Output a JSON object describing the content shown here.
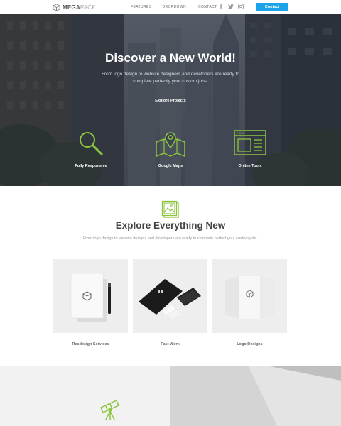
{
  "brand": {
    "name_strong": "MEGA",
    "name_light": "PACK"
  },
  "nav": {
    "links": [
      "FEATURES",
      "DROPDOWN",
      "CONTACT"
    ],
    "social_icons": [
      "facebook-icon",
      "twitter-icon",
      "instagram-icon"
    ],
    "contact_button": "Contact"
  },
  "hero": {
    "title": "Discover a New World!",
    "subtitle": "From logo design to website designers and developers are ready to complete perfectly your custom jobs.",
    "button": "Explore Projects",
    "features": [
      {
        "icon": "magnifier-icon",
        "label": "Fully Responsive"
      },
      {
        "icon": "map-pin-icon",
        "label": "Google Maps"
      },
      {
        "icon": "browser-window-icon",
        "label": "Online Tools"
      }
    ]
  },
  "explore": {
    "icon": "image-gallery-icon",
    "title": "Explore Everything New",
    "subtitle": "From logo design to website designs and developers are ready to complete perfect your custom jobs.",
    "cards": [
      {
        "image": "notebook-pen-mockup",
        "title": "Resdesign Services"
      },
      {
        "image": "stationery-mockup",
        "title": "Fast Work"
      },
      {
        "image": "trifold-brochure-mockup",
        "title": "Logo Designs"
      }
    ]
  },
  "bottom": {
    "icon": "telescope-icon"
  },
  "colors": {
    "accent_blue": "#1aa3e8",
    "accent_green": "#8cc63f",
    "hero_overlay": "#2e3440",
    "heading_text": "#444444"
  }
}
